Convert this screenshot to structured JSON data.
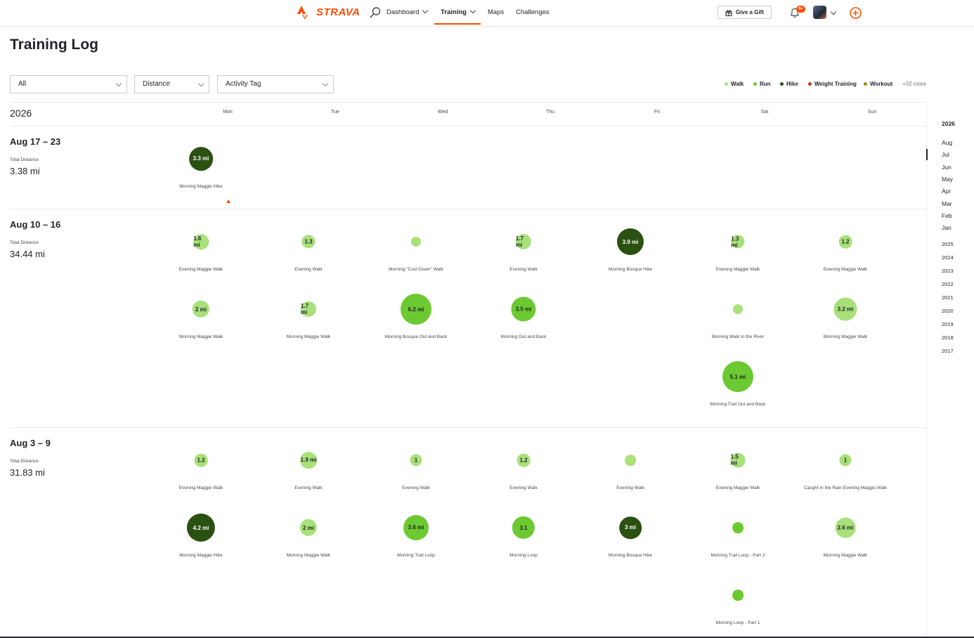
{
  "brand": {
    "name": "STRAVA",
    "color": "#fc4c02"
  },
  "nav": {
    "dashboard": "Dashboard",
    "training": "Training",
    "maps": "Maps",
    "challenges": "Challenges",
    "gift": "Give a Gift",
    "notifications_badge": "9+"
  },
  "page": {
    "title": "Training Log"
  },
  "filters": {
    "sport": "All",
    "metric": "Distance",
    "tag": "Activity Tag"
  },
  "legend": {
    "items": [
      {
        "label": "Walk",
        "color": "#a8e07a"
      },
      {
        "label": "Run",
        "color": "#6cc932"
      },
      {
        "label": "Hike",
        "color": "#2b5112"
      },
      {
        "label": "Weight Training",
        "color": "#c2410c"
      },
      {
        "label": "Workout",
        "color": "#b5850f"
      }
    ],
    "more": "+32 more"
  },
  "calendar": {
    "year": "2026",
    "days": [
      "Mon",
      "Tue",
      "Wed",
      "Thu",
      "Fri",
      "Sat",
      "Sun"
    ]
  },
  "total_label": "Total Distance",
  "weeks": [
    {
      "range": "Aug 17 – 23",
      "total": "3.38 mi",
      "activities": [
        {
          "day": 0,
          "row": 0,
          "type": "hike",
          "value": "3.3 mi",
          "name": "Morning Maggie Hike",
          "miles": 3.3
        }
      ]
    },
    {
      "range": "Aug 10 – 16",
      "total": "34.44 mi",
      "activities": [
        {
          "day": 0,
          "row": 0,
          "type": "walk",
          "value": "1.6 mi",
          "name": "Evening Maggie Walk",
          "miles": 1.6
        },
        {
          "day": 1,
          "row": 0,
          "type": "walk",
          "value": "1.3",
          "name": "Evening Walk",
          "miles": 1.3
        },
        {
          "day": 2,
          "row": 0,
          "type": "walk",
          "value": "",
          "name": "Morning \"Cool Down\" Walk",
          "miles": 0.5
        },
        {
          "day": 3,
          "row": 0,
          "type": "walk",
          "value": "1.7 mi",
          "name": "Evening Walk",
          "miles": 1.7
        },
        {
          "day": 4,
          "row": 0,
          "type": "hike",
          "value": "3.9 mi",
          "name": "Morning Bosque Hike",
          "miles": 3.9
        },
        {
          "day": 5,
          "row": 0,
          "type": "walk",
          "value": "1.3 mi",
          "name": "Evening Maggie Walk",
          "miles": 1.3
        },
        {
          "day": 6,
          "row": 0,
          "type": "walk",
          "value": "1.2",
          "name": "Evening Maggie Walk",
          "miles": 1.2
        },
        {
          "day": 0,
          "row": 1,
          "type": "walk",
          "value": "2 mi",
          "name": "Morning Maggie Walk",
          "miles": 2.0
        },
        {
          "day": 1,
          "row": 1,
          "type": "walk",
          "value": "1.7 mi",
          "name": "Morning Maggie Walk",
          "miles": 1.7
        },
        {
          "day": 2,
          "row": 1,
          "type": "run",
          "value": "6.2 mi",
          "name": "Morning Bosque Out and Back",
          "miles": 6.2
        },
        {
          "day": 3,
          "row": 1,
          "type": "run",
          "value": "3.5 mi",
          "name": "Morning Out and Back",
          "miles": 3.5
        },
        {
          "day": 5,
          "row": 1,
          "type": "walk",
          "value": "",
          "name": "Morning Walk to the River",
          "miles": 0.5
        },
        {
          "day": 6,
          "row": 1,
          "type": "walk",
          "value": "3.2 mi",
          "name": "Morning Maggie Walk",
          "miles": 3.2
        },
        {
          "day": 5,
          "row": 2,
          "type": "run",
          "value": "5.1 mi",
          "name": "Morning Trail Out and Back",
          "miles": 5.1
        }
      ]
    },
    {
      "range": "Aug 3 – 9",
      "total": "31.83 mi",
      "activities": [
        {
          "day": 0,
          "row": 0,
          "type": "walk",
          "value": "1.2",
          "name": "Evening Maggie Walk",
          "miles": 1.2
        },
        {
          "day": 1,
          "row": 0,
          "type": "walk",
          "value": "1.9 mi",
          "name": "Evening Walk",
          "miles": 1.9
        },
        {
          "day": 2,
          "row": 0,
          "type": "walk",
          "value": "1",
          "name": "Evening Walk",
          "miles": 1.0
        },
        {
          "day": 3,
          "row": 0,
          "type": "walk",
          "value": "1.2",
          "name": "Evening Walk",
          "miles": 1.2
        },
        {
          "day": 4,
          "row": 0,
          "type": "walk",
          "value": "",
          "name": "Evening Walk",
          "miles": 0.8
        },
        {
          "day": 5,
          "row": 0,
          "type": "walk",
          "value": "1.5 mi",
          "name": "Evening Maggie Walk",
          "miles": 1.5
        },
        {
          "day": 6,
          "row": 0,
          "type": "walk",
          "value": "1",
          "name": "Caught in the Rain Evening Maggie Walk",
          "miles": 1.0
        },
        {
          "day": 0,
          "row": 1,
          "type": "hike",
          "value": "4.2 mi",
          "name": "Morning Maggie Hike",
          "miles": 4.2
        },
        {
          "day": 1,
          "row": 1,
          "type": "walk",
          "value": "2 mi",
          "name": "Morning Maggie Walk",
          "miles": 2.0
        },
        {
          "day": 2,
          "row": 1,
          "type": "run",
          "value": "3.6 mi",
          "name": "Morning Trail Loop",
          "miles": 3.6
        },
        {
          "day": 3,
          "row": 1,
          "type": "run",
          "value": "3.1",
          "name": "Morning Loop",
          "miles": 3.1
        },
        {
          "day": 4,
          "row": 1,
          "type": "hike",
          "value": "3 mi",
          "name": "Morning Bosque Hike",
          "miles": 3.0
        },
        {
          "day": 5,
          "row": 1,
          "type": "run",
          "value": "",
          "name": "Morning Trail Loop - Part 2",
          "miles": 0.8
        },
        {
          "day": 6,
          "row": 1,
          "type": "walk",
          "value": "2.6 mi",
          "name": "Morning Maggie Walk",
          "miles": 2.6
        },
        {
          "day": 5,
          "row": 2,
          "type": "run",
          "value": "",
          "name": "Morning Loop - Part 1",
          "miles": 0.8
        }
      ]
    }
  ],
  "sidebar": {
    "current_year": "2026",
    "months": [
      "Aug",
      "Jul",
      "Jun",
      "May",
      "Apr",
      "Mar",
      "Feb",
      "Jan"
    ],
    "active_month": "Jul",
    "years": [
      "2025",
      "2024",
      "2023",
      "2022",
      "2021",
      "2020",
      "2019",
      "2018",
      "2017"
    ]
  }
}
